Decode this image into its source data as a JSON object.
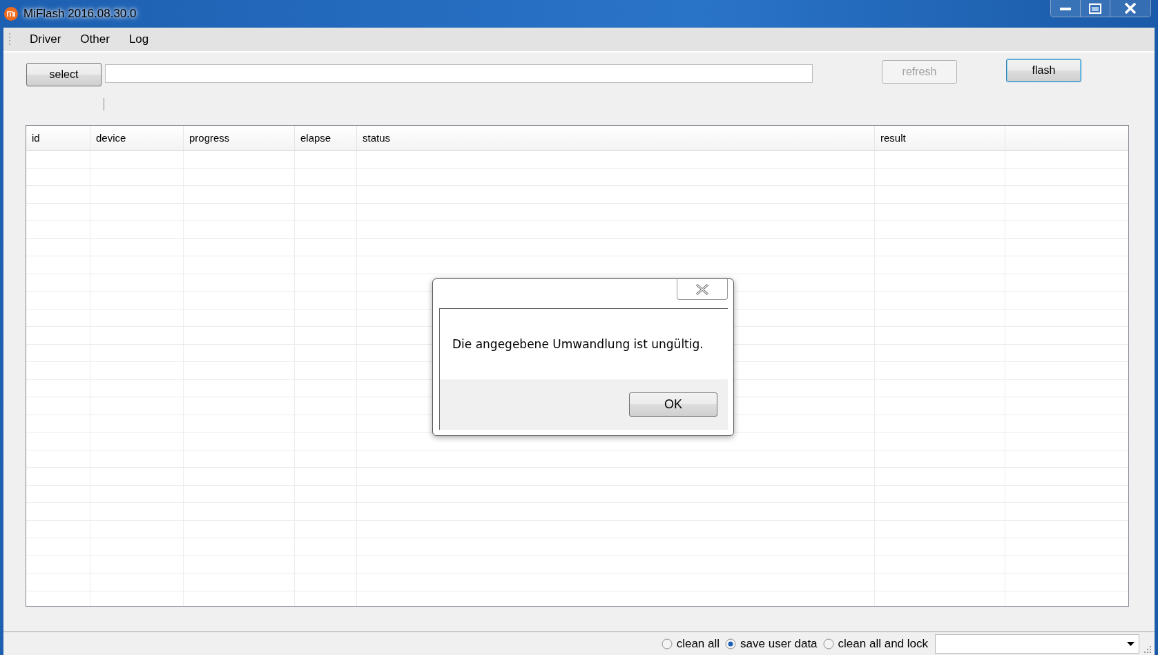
{
  "window": {
    "title": "MiFlash 2016.08.30.0"
  },
  "menu": [
    "Driver",
    "Other",
    "Log"
  ],
  "toolbar": {
    "select_button": "select",
    "refresh_button": {
      "label": "refresh",
      "disabled": true
    },
    "flash_button": {
      "label": "flash",
      "focused": true
    }
  },
  "table": {
    "columns": [
      "id",
      "device",
      "progress",
      "elapse",
      "status",
      "result"
    ]
  },
  "dialog": {
    "message": "Die angegebene Umwandlung ist ungültig.",
    "ok_button": "OK"
  },
  "status_bar": {
    "options": [
      {
        "label": "clean all",
        "selected": false
      },
      {
        "label": "save user data",
        "selected": true
      },
      {
        "label": "clean all and lock",
        "selected": false
      }
    ]
  }
}
